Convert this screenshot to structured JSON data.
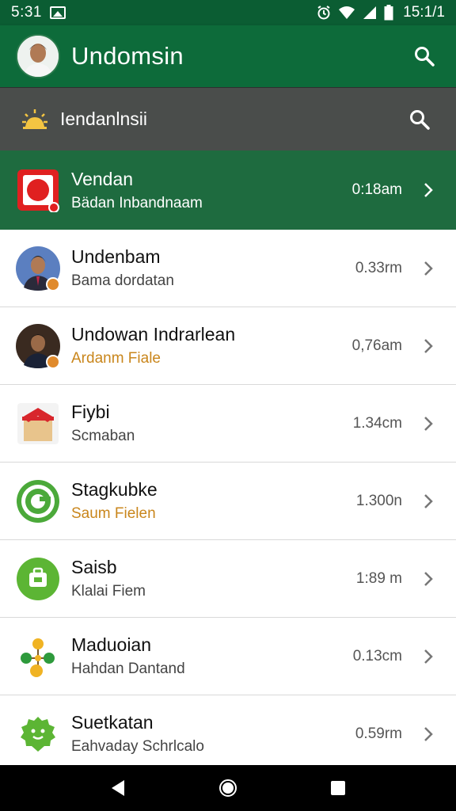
{
  "status": {
    "time": "5:31",
    "clock": "15:1/1"
  },
  "app_bar": {
    "title": "Undomsin"
  },
  "sub_bar": {
    "title": "Iendanlnsii"
  },
  "colors": {
    "primary": "#0d6b3a",
    "subbar": "#4a4d4b",
    "accent": "#c9861c",
    "highlight": "#1e6b3f"
  },
  "rows": [
    {
      "title": "Vendan",
      "subtitle": "Bädan Inbandnaam",
      "meta": "0:18am",
      "icon": "red-square-app-icon"
    },
    {
      "title": "Undenbam",
      "subtitle": "Bama dordatan",
      "meta": "0.33rm",
      "icon": "person-avatar-icon"
    },
    {
      "title": "Undowan Indrarlean",
      "subtitle": "Ardanm Fiale",
      "meta": "0,76am",
      "icon": "person-avatar-icon"
    },
    {
      "title": "Fiybi",
      "subtitle": "Scmaban",
      "meta": "1.34cm",
      "icon": "gift-box-icon"
    },
    {
      "title": "Stagkubke",
      "subtitle": "Saum Fielen",
      "meta": "1.300n",
      "icon": "green-c-icon"
    },
    {
      "title": "Saisb",
      "subtitle": "Klalai Fiem",
      "meta": "1:89 m",
      "icon": "green-bag-icon"
    },
    {
      "title": "Maduoian",
      "subtitle": "Hahdan Dantand",
      "meta": "0.13cm",
      "icon": "molecule-icon"
    },
    {
      "title": "Suetkatan",
      "subtitle": "Eahvaday Schrlcalo",
      "meta": "0.59rm",
      "icon": "green-leaf-badge-icon"
    }
  ]
}
